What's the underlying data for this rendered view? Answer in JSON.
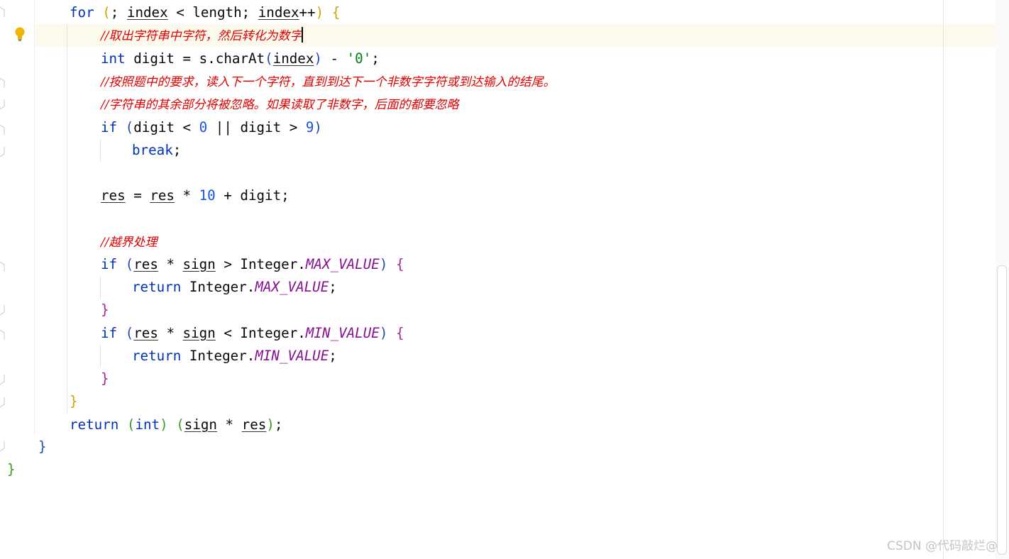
{
  "editor": {
    "lines": [
      {
        "id": "for-loop-header"
      },
      {
        "id": "comment-1",
        "text": "//取出字符串中字符，然后转化为数字"
      },
      {
        "id": "digit-declaration"
      },
      {
        "id": "comment-2",
        "text": "//按照题中的要求，读入下一个字符，直到到达下一个非数字字符或到达输入的结尾。"
      },
      {
        "id": "comment-3",
        "text": "//字符串的其余部分将被忽略。如果读取了非数字，后面的都要忽略"
      },
      {
        "id": "if-digit-check"
      },
      {
        "id": "break-statement"
      },
      {
        "id": "res-assignment"
      },
      {
        "id": "comment-4",
        "text": "//越界处理"
      },
      {
        "id": "if-max-check"
      },
      {
        "id": "return-max"
      },
      {
        "id": "if-min-check"
      },
      {
        "id": "return-min"
      },
      {
        "id": "return-final"
      }
    ],
    "tokens": {
      "kw_for": "for",
      "kw_int": "int",
      "kw_if": "if",
      "kw_break": "break",
      "kw_return": "return",
      "var_index": "index",
      "var_length": "length",
      "var_digit": "digit",
      "var_s": "s",
      "method_charAt": "charAt",
      "var_res": "res",
      "var_sign": "sign",
      "cls_integer": "Integer",
      "const_max": "MAX_VALUE",
      "const_min": "MIN_VALUE",
      "num_0": "0",
      "num_9": "9",
      "num_10": "10",
      "str_zero": "'0'"
    }
  },
  "gutter": {
    "intention_icon": "lightbulb-icon"
  },
  "watermark": "CSDN @代码敲烂@",
  "colors": {
    "keyword": "#0033b3",
    "number": "#1750eb",
    "string": "#067d17",
    "constant": "#871094",
    "comment": "#e00000",
    "current_line": "#fcfaed",
    "bulb": "#f0b400"
  }
}
